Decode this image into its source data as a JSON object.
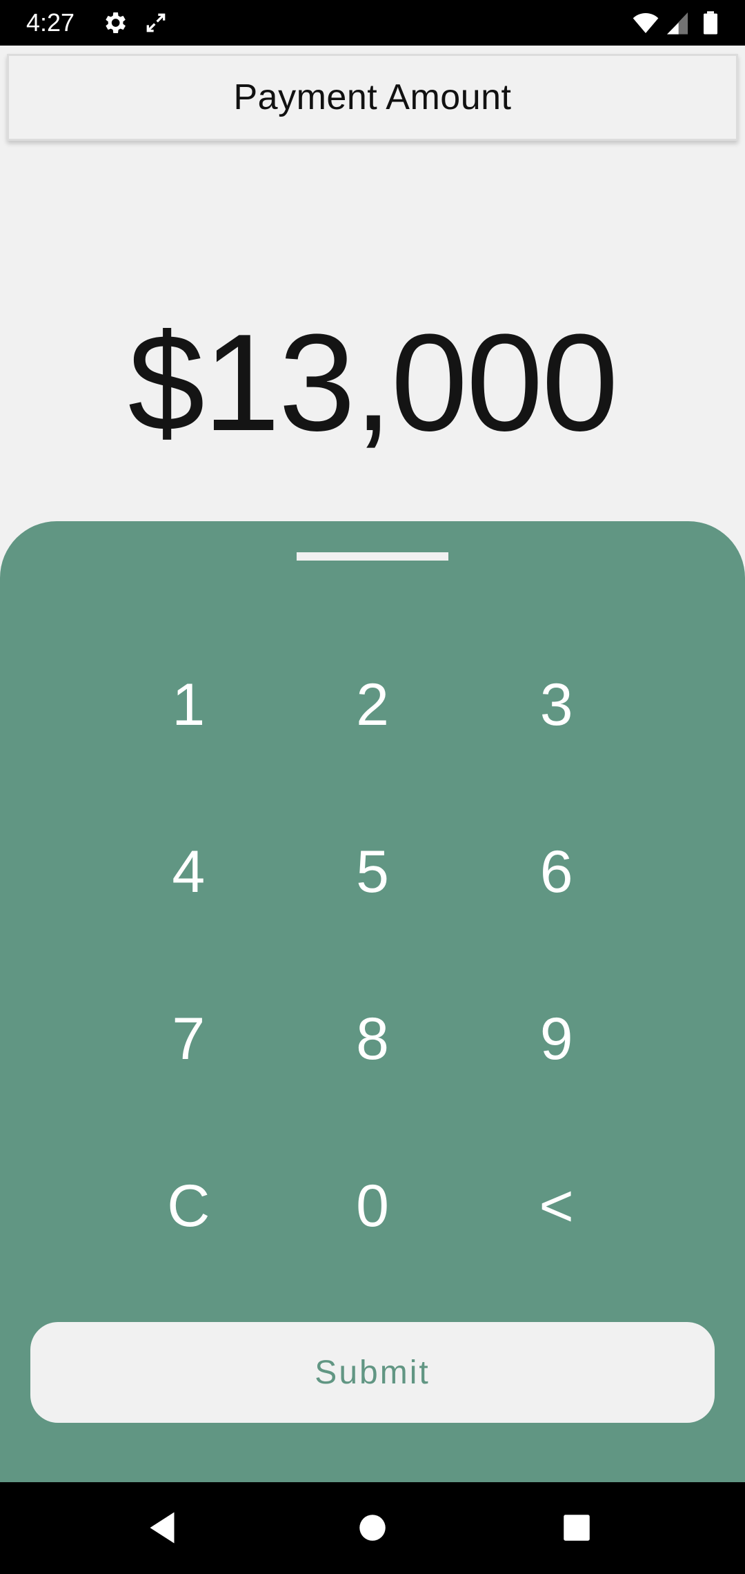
{
  "status_bar": {
    "time": "4:27",
    "icons": [
      "gear-icon",
      "screen-rotate-icon",
      "wifi-icon",
      "cell-signal-icon",
      "battery-icon"
    ]
  },
  "header": {
    "title": "Payment Amount"
  },
  "amount": {
    "display": "$13,000"
  },
  "keypad": {
    "keys": [
      "1",
      "2",
      "3",
      "4",
      "5",
      "6",
      "7",
      "8",
      "9",
      "C",
      "0",
      "<"
    ]
  },
  "submit": {
    "label": "Submit"
  },
  "colors": {
    "accent": "#619683",
    "background": "#f1f1f1",
    "text": "#141414"
  },
  "nav_bar": {
    "icons": [
      "back-icon",
      "home-icon",
      "recents-icon"
    ]
  }
}
